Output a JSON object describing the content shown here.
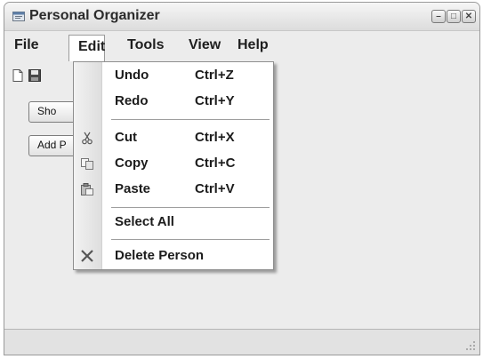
{
  "window": {
    "title": "Personal Organizer",
    "controls": {
      "minimize": "–",
      "maximize": "□",
      "close": "✕"
    }
  },
  "menubar": {
    "items": [
      {
        "name": "file",
        "label": "File"
      },
      {
        "name": "edit",
        "label": "Edit"
      },
      {
        "name": "tools",
        "label": "Tools"
      },
      {
        "name": "view",
        "label": "View"
      },
      {
        "name": "help",
        "label": "Help"
      }
    ]
  },
  "toolbar": {
    "icons": [
      "new-document-icon",
      "save-icon"
    ]
  },
  "buttons": {
    "show": "Sho",
    "add": "Add P"
  },
  "edit_menu": {
    "open": true,
    "items": [
      {
        "label": "Undo",
        "shortcut": "Ctrl+Z"
      },
      {
        "label": "Redo",
        "shortcut": "Ctrl+Y"
      },
      {
        "label": "Cut",
        "shortcut": "Ctrl+X",
        "icon": "scissors-icon"
      },
      {
        "label": "Copy",
        "shortcut": "Ctrl+C",
        "icon": "copy-icon"
      },
      {
        "label": "Paste",
        "shortcut": "Ctrl+V",
        "icon": "paste-icon"
      },
      {
        "label": "Select All",
        "shortcut": ""
      },
      {
        "label": "Delete Person",
        "shortcut": "",
        "icon": "delete-icon"
      }
    ]
  }
}
